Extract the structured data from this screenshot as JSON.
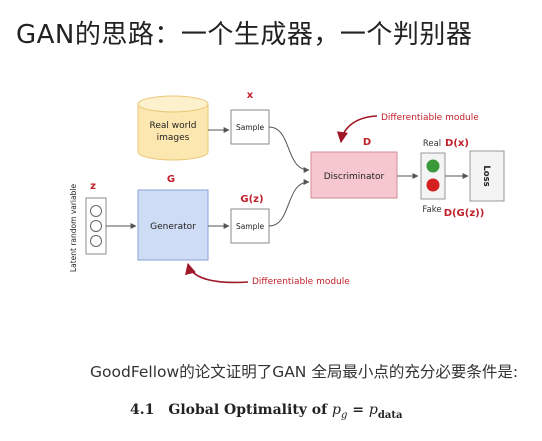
{
  "title": "GAN的思路：一个生成器，一个判别器",
  "diagram": {
    "real_world_images": [
      "Real world",
      "images"
    ],
    "x_label": "x",
    "sample_top": "Sample",
    "sample_bottom": "Sample",
    "z_label": "z",
    "latent_label": "Latent random variable",
    "g_label": "G",
    "generator": "Generator",
    "gz_label": "G(z)",
    "d_label": "D",
    "discriminator": "Discriminator",
    "diff_module_top": "Differentiable module",
    "diff_module_bottom": "Differentiable module",
    "real": "Real",
    "fake": "Fake",
    "dx": "D(x)",
    "dgz": "D(G(z))",
    "loss": "Loss",
    "colors": {
      "red_label": "#c0202a",
      "generator_fill": "#cfdcf5",
      "discriminator_fill": "#f6c7cf",
      "images_fill": "#fde7b0",
      "green_light": "#3a9a3a",
      "red_light": "#d42020"
    }
  },
  "caption": "GoodFellow的论文证明了GAN 全局最小点的充分必要条件是:",
  "section": {
    "number": "4.1",
    "text": "Global Optimality of",
    "p": "p",
    "g": "g",
    "eq": " = ",
    "data": "data"
  }
}
